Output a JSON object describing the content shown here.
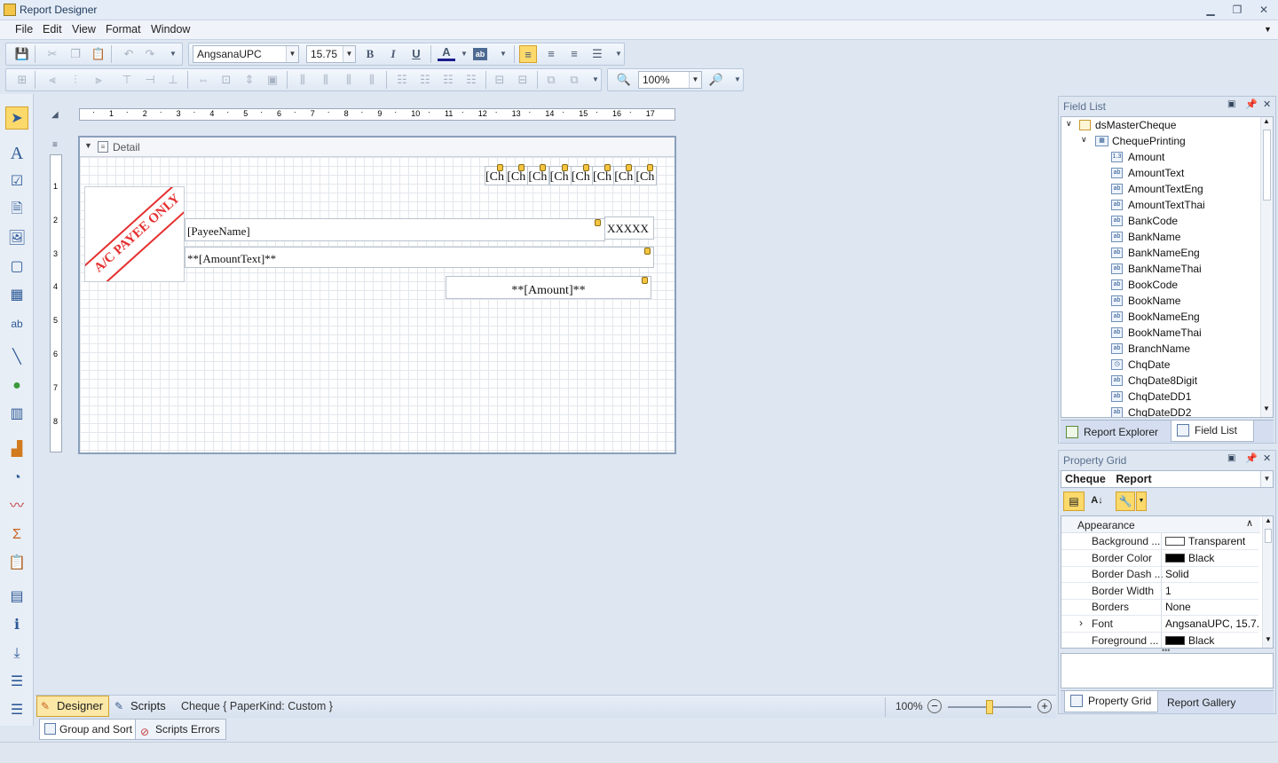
{
  "window": {
    "title": "Report Designer"
  },
  "menu": [
    "File",
    "Edit",
    "View",
    "Format",
    "Window"
  ],
  "toolbar": {
    "font_name": "AngsanaUPC",
    "font_size": "15.75",
    "zoom": "100%"
  },
  "band": {
    "name": "Detail"
  },
  "ruler": {
    "h_ticks": [
      "1",
      "2",
      "3",
      "4",
      "5",
      "6",
      "7",
      "8",
      "9",
      "10",
      "11",
      "12",
      "13",
      "14",
      "15",
      "16",
      "17"
    ],
    "v_ticks": [
      "1",
      "2",
      "3",
      "4",
      "5",
      "6",
      "7",
      "8"
    ]
  },
  "report_controls": {
    "stamp_text": "A/C PAYEE ONLY",
    "date_boxes": [
      "[Ch",
      "[Ch",
      "[Ch",
      "[Ch",
      "[Ch",
      "[Ch",
      "[Ch",
      "[Ch"
    ],
    "payee": "[PayeeName]",
    "xxxxx": "XXXXX",
    "amount_text": "**[AmountText]**",
    "amount": "**[Amount]**"
  },
  "field_list": {
    "title": "Field List",
    "root": "dsMasterCheque",
    "table": "ChequePrinting",
    "fields": [
      {
        "name": "Amount",
        "type": "1.3"
      },
      {
        "name": "AmountText",
        "type": "ab"
      },
      {
        "name": "AmountTextEng",
        "type": "ab"
      },
      {
        "name": "AmountTextThai",
        "type": "ab"
      },
      {
        "name": "BankCode",
        "type": "ab"
      },
      {
        "name": "BankName",
        "type": "ab"
      },
      {
        "name": "BankNameEng",
        "type": "ab"
      },
      {
        "name": "BankNameThai",
        "type": "ab"
      },
      {
        "name": "BookCode",
        "type": "ab"
      },
      {
        "name": "BookName",
        "type": "ab"
      },
      {
        "name": "BookNameEng",
        "type": "ab"
      },
      {
        "name": "BookNameThai",
        "type": "ab"
      },
      {
        "name": "BranchName",
        "type": "ab"
      },
      {
        "name": "ChqDate",
        "type": "◷"
      },
      {
        "name": "ChqDate8Digit",
        "type": "ab"
      },
      {
        "name": "ChqDateDD1",
        "type": "ab"
      },
      {
        "name": "ChqDateDD2",
        "type": "ab"
      }
    ],
    "tabs": [
      "Report Explorer",
      "Field List"
    ]
  },
  "property_grid": {
    "title": "Property Grid",
    "object_name": "Cheque",
    "object_type": "Report",
    "category": "Appearance",
    "rows": [
      {
        "name": "Background ...",
        "value": "Transparent",
        "swatch": "#ffffff",
        "expand": ""
      },
      {
        "name": "Border Color",
        "value": "Black",
        "swatch": "#000000",
        "expand": ""
      },
      {
        "name": "Border Dash ...",
        "value": "Solid",
        "swatch": "",
        "expand": ""
      },
      {
        "name": "Border Width",
        "value": "1",
        "swatch": "",
        "expand": ""
      },
      {
        "name": "Borders",
        "value": "None",
        "swatch": "",
        "expand": ""
      },
      {
        "name": "Font",
        "value": "AngsanaUPC, 15.7...",
        "swatch": "",
        "expand": "›"
      },
      {
        "name": "Foreground ...",
        "value": "Black",
        "swatch": "#000000",
        "expand": ""
      }
    ],
    "tabs": [
      "Property Grid",
      "Report Gallery"
    ]
  },
  "status": {
    "designer_tab": "Designer",
    "scripts_tab": "Scripts",
    "report_info": "Cheque { PaperKind: Custom }",
    "zoom": "100%",
    "zoom_fraction": 0.5
  },
  "bottom_tabs": [
    "Group and Sort",
    "Scripts Errors"
  ],
  "colors": {
    "accent": "#f5c542",
    "stamp_red": "#e53030"
  }
}
